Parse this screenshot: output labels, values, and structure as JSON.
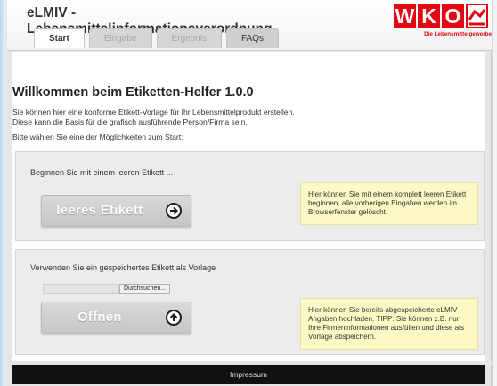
{
  "header": {
    "title_line1": "eLMIV -",
    "title_line2": "Lebensmittelinformationsverordnung",
    "logo": {
      "letters": [
        "W",
        "K",
        "O"
      ],
      "tagline": "Die Lebensmittelgewerbe",
      "brand_color": "#e30613"
    }
  },
  "tabs": [
    {
      "label": "Start",
      "state": "active"
    },
    {
      "label": "Eingabe",
      "state": "disabled"
    },
    {
      "label": "Ergebnis",
      "state": "disabled"
    },
    {
      "label": "FAQs",
      "state": "enabled"
    }
  ],
  "main": {
    "title": "Willkommen beim Etiketten-Helfer 1.0.0",
    "intro_line1": "Sie können hier eine konforme Etikett-Vorlage für Ihr Lebensmittelprodukt erstellen.",
    "intro_line2": "Diese kann die Basis für die grafisch ausführende Person/Firma sein.",
    "choose_text": "Bitte wählen Sie eine der Möglichkeiten zum Start:"
  },
  "panel_new": {
    "label": "Beginnen Sie mit einem leeren Etikett ...",
    "button_label": "leeres Etikett",
    "button_icon": "arrow-right-circle-icon",
    "note": "Hier können Sie mit einem komplett leeren Etikett beginnen, alle vorherigen Eingaben werden im Browserfenster gelöscht."
  },
  "panel_open": {
    "label": "Verwenden Sie ein gespeichertes Etikett als Vorlage",
    "file_button": "Durchsuchen...",
    "button_label": "Öffnen",
    "button_icon": "arrow-up-circle-icon",
    "note": "Hier können Sie bereits abgespeicherte eLMIV Angaben hochladen. TIPP: Sie können z.B. nur Ihre Firmeninformationen ausfüllen und diese als Vorlage abspeichern."
  },
  "footer": {
    "link": "Impressum"
  },
  "colors": {
    "note_background": "#fdf9c4",
    "footer_background": "#111111",
    "panel_background": "#ececec"
  }
}
